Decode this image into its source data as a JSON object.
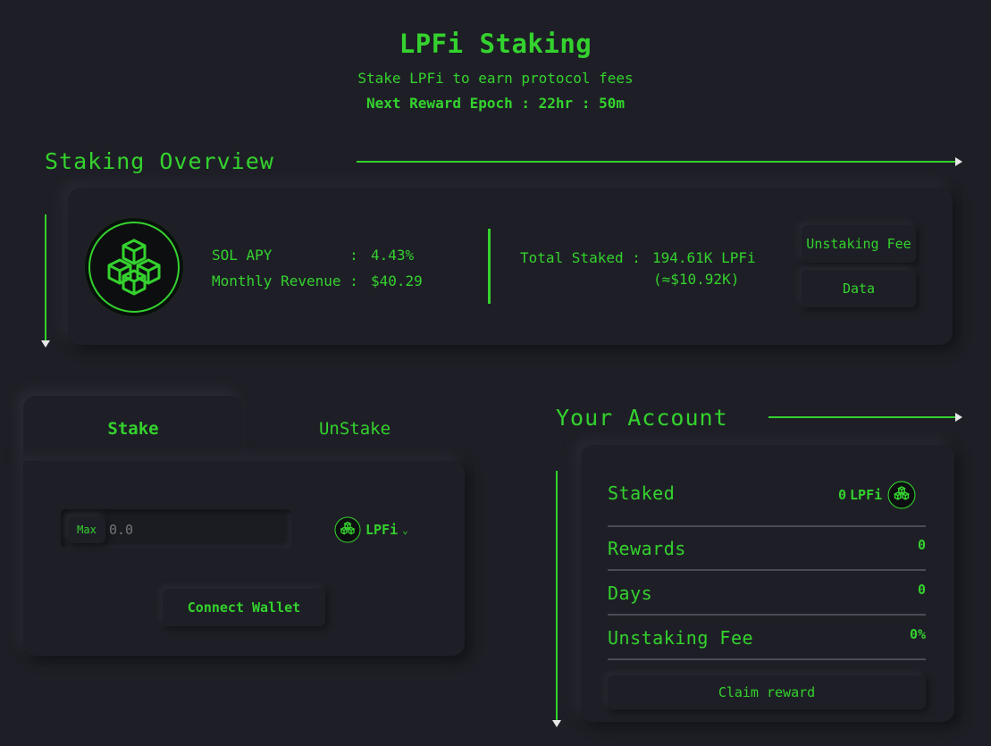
{
  "header": {
    "title": "LPFi Staking",
    "subtitle": "Stake LPFi to earn protocol fees",
    "epoch": "Next Reward Epoch : 22hr : 50m"
  },
  "overview": {
    "section_title": "Staking Overview",
    "sol_apy_label": "SOL APY         :",
    "sol_apy_value": "4.43%",
    "monthly_revenue_label": "Monthly Revenue :",
    "monthly_revenue_value": "$40.29",
    "total_staked_label": "Total Staked :",
    "total_staked_value": "194.61K LPFi",
    "total_staked_usd": "(≈$10.92K)",
    "unstaking_fee_button": "Unstaking Fee",
    "data_button": "Data"
  },
  "stake_panel": {
    "tab_stake": "Stake",
    "tab_unstake": "UnStake",
    "max_label": "Max",
    "amount_placeholder": "0.0",
    "token_label": "LPFi",
    "connect_wallet": "Connect Wallet"
  },
  "account": {
    "section_title": "Your Account",
    "staked_label": "Staked",
    "staked_value": "0",
    "staked_token": "LPFi",
    "rewards_label": "Rewards",
    "rewards_value": "0",
    "days_label": "Days",
    "days_value": "0",
    "unstaking_fee_label": "Unstaking Fee",
    "unstaking_fee_value": "0%",
    "claim_button": "Claim reward"
  },
  "colors": {
    "background": "#1e1f26",
    "accent": "#34d22e"
  },
  "icons": {
    "token": "lpfi-cubes-icon",
    "dropdown": "chevron-down-icon"
  }
}
